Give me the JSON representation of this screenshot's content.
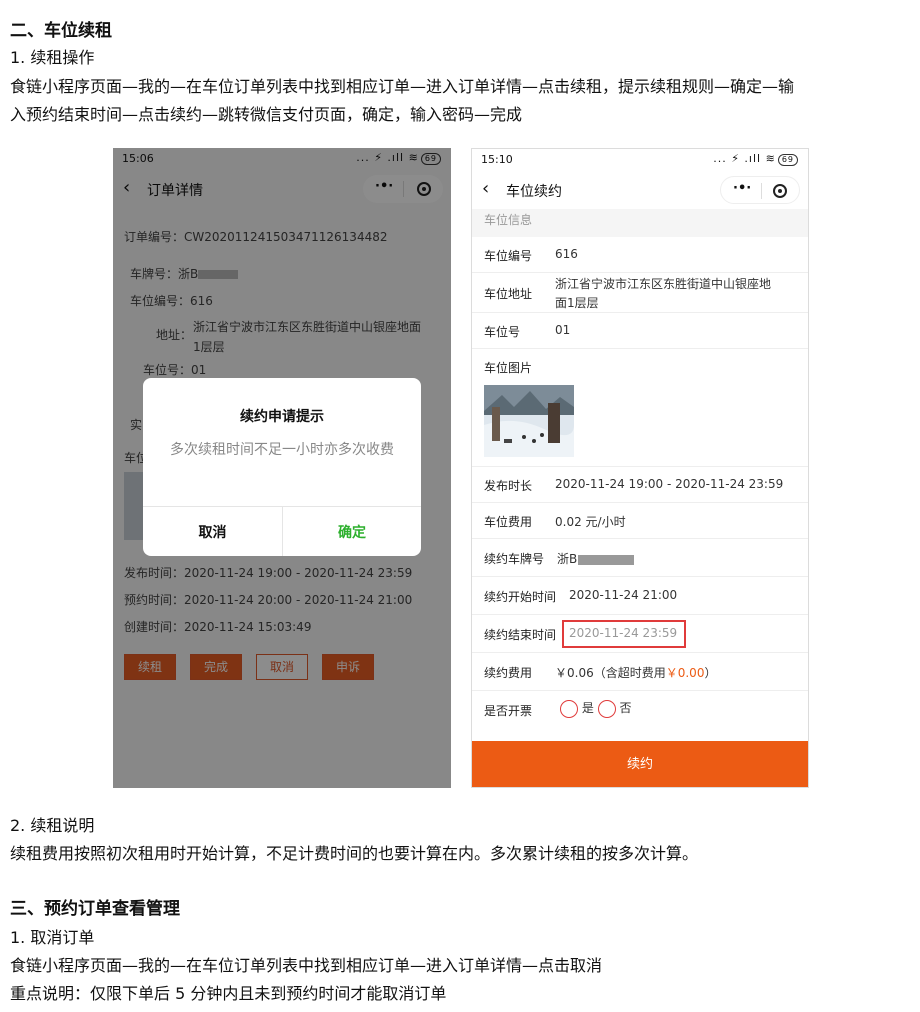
{
  "doc": {
    "section2_title": "二、车位续租",
    "sub1_title": "1. 续租操作",
    "sub1_line1": "食链小程序页面—我的—在车位订单列表中找到相应订单—进入订单详情—点击续租，提示续租规则—确定—输",
    "sub1_line2": "入预约结束时间—点击续约—跳转微信支付页面，确定，输入密码—完成",
    "sub2_title": "2. 续租说明",
    "sub2_line1": "续租费用按照初次租用时开始计算，不足计费时间的也要计算在内。多次累计续租的按多次计算。",
    "section3_title": "三、预约订单查看管理",
    "sub3_title": "1. 取消订单",
    "sub3_line1": "食链小程序页面—我的—在车位订单列表中找到相应订单—进入订单详情—点击取消",
    "sub3_line2": "重点说明：仅限下单后 5 分钟内且未到预约时间才能取消订单"
  },
  "left_phone": {
    "time": "15:06",
    "status_icons": "... ⚡ .ıll ≋",
    "battery": "69",
    "back": "‹",
    "title": "订单详情",
    "capsule_dots": "·•·",
    "order_no": "订单编号：CW202011241503471126134482",
    "plate_label": "车牌号：",
    "plate_value": "浙B",
    "space_no": "车位编号：616",
    "address_label": "地址：",
    "address_line1": "浙江省宁波市江东区东胜街道中山银座地面",
    "address_line2": "1层层",
    "space_num": "车位号：01",
    "partial_a": "实",
    "partial_b": "车位",
    "publish_time": "发布时间：2020-11-24 19:00 - 2020-11-24 23:59",
    "reserve_time": "预约时间：2020-11-24 20:00 - 2020-11-24 21:00",
    "create_time": "创建时间：2020-11-24 15:03:49",
    "buttons": [
      "续租",
      "完成",
      "取消",
      "申诉"
    ],
    "dialog": {
      "title": "续约申请提示",
      "message": "多次续租时间不足一小时亦多次收费",
      "cancel": "取消",
      "confirm": "确定"
    }
  },
  "right_phone": {
    "time": "15:10",
    "status_icons": "... ⚡ .ıll ≋",
    "battery": "69",
    "back": "‹",
    "title": "车位续约",
    "capsule_dots": "·•·",
    "section": "车位信息",
    "rows": [
      {
        "label": "车位编号",
        "value": "616"
      },
      {
        "label": "车位地址",
        "value": "浙江省宁波市江东区东胜街道中山银座地",
        "value2": "面1层层"
      },
      {
        "label": "车位号",
        "value": "01"
      },
      {
        "label": "车位图片",
        "value": ""
      },
      {
        "label": "发布时长",
        "value": "2020-11-24 19:00 - 2020-11-24 23:59"
      },
      {
        "label": "车位费用",
        "value": "0.02 元/小时"
      },
      {
        "label": "续约车牌号",
        "value": "浙B"
      },
      {
        "label": "续约开始时间",
        "value": "2020-11-24 21:00"
      },
      {
        "label": "续约结束时间",
        "value": "2020-11-24 23:59"
      },
      {
        "label": "续约费用",
        "value": "￥0.06（含超时费用",
        "extra": "￥0.00",
        "close": "）"
      },
      {
        "label": "是否开票",
        "opt_yes": "是",
        "opt_no": "否"
      }
    ],
    "submit": "续约",
    "colors": {
      "accent": "#ec5b14",
      "confirm": "#2db02d",
      "highlight": "#e03b3b"
    }
  }
}
